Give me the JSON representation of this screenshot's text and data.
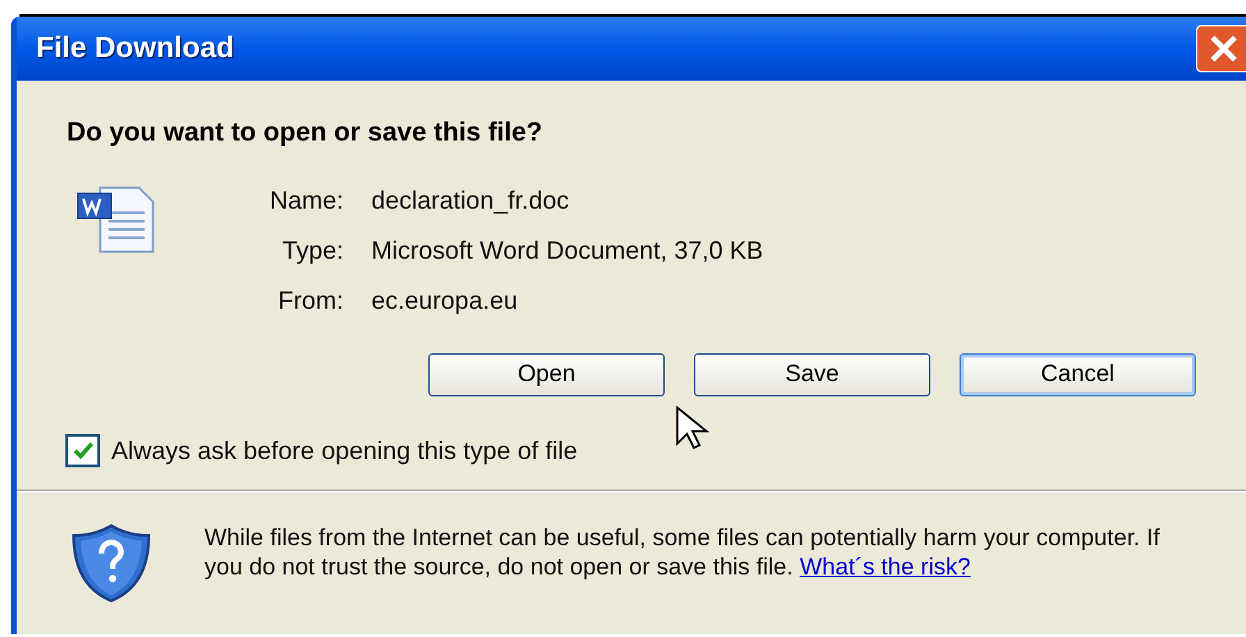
{
  "window": {
    "title": "File Download"
  },
  "question": "Do you want to open or save this file?",
  "fields": [
    {
      "label": "Name:",
      "value": "declaration_fr.doc"
    },
    {
      "label": "Type:",
      "value": "Microsoft Word Document, 37,0 KB"
    },
    {
      "label": "From:",
      "value": "ec.europa.eu"
    }
  ],
  "buttons": [
    {
      "label": "Open",
      "selected": false
    },
    {
      "label": "Save",
      "selected": false
    },
    {
      "label": "Cancel",
      "selected": true
    }
  ],
  "checkbox": {
    "label": "Always ask before opening this type of file",
    "checked": true
  },
  "warning": {
    "text": "While files from the Internet can be useful, some files can potentially harm your computer. If you do not trust the source, do not open or save this file.",
    "link": "What´s the risk?"
  }
}
